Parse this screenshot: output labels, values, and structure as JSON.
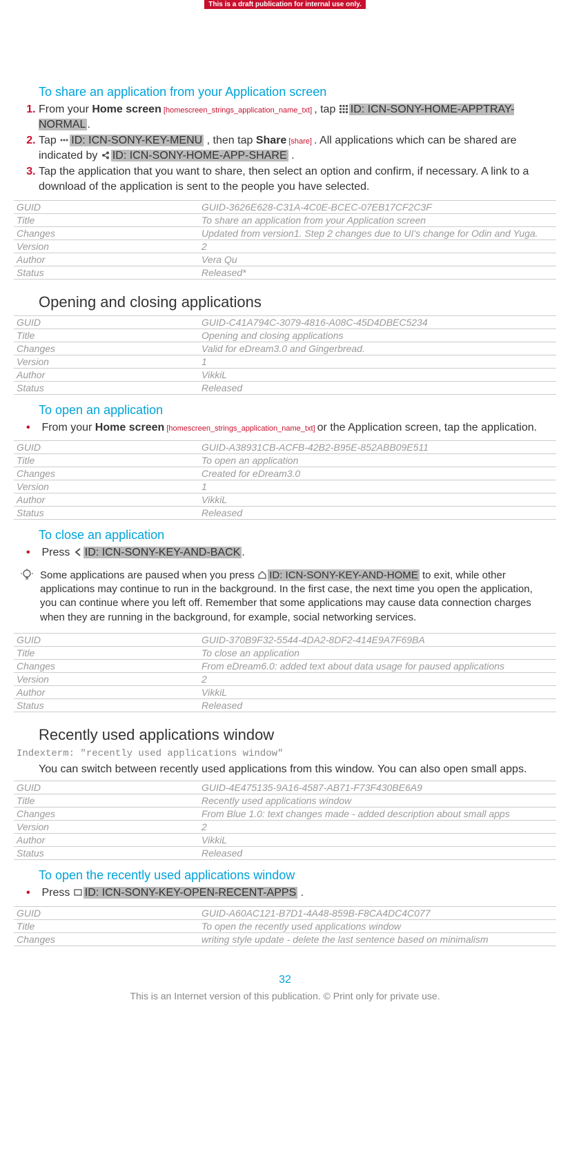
{
  "banner": "This is a draft publication for internal use only.",
  "sec1": {
    "title": "To share an application from your Application screen",
    "step1_a": "From your ",
    "step1_home": "Home screen",
    "step1_ref": " [homescreen_strings_application_name_txt] ",
    "step1_b": ", tap ",
    "step1_icon": "ID: ICN-SONY-HOME-APPTRAY-NORMAL",
    "step1_c": ".",
    "step2_a": "Tap ",
    "step2_icon1": "ID: ICN-SONY-KEY-MENU",
    "step2_b": " , then tap ",
    "step2_share": "Share",
    "step2_ref": " [share] ",
    "step2_c": ". All applications which can be shared are indicated by ",
    "step2_icon2": "ID: ICN-SONY-HOME-APP-SHARE",
    "step2_d": " .",
    "step3": "Tap the application that you want to share, then select an option and confirm, if necessary. A link to a download of the application is sent to the people you have selected."
  },
  "meta1": {
    "GUID": "GUID-3626E628-C31A-4C0E-BCEC-07EB17CF2C3F",
    "Title": "To share an application from your Application screen",
    "Changes": "Updated from version1. Step 2 changes due to UI's change for Odin and Yuga.",
    "Version": "2",
    "Author": "Vera Qu",
    "Status": "Released*"
  },
  "sec2": {
    "title": "Opening and closing applications"
  },
  "meta2": {
    "GUID": "GUID-C41A794C-3079-4816-A08C-45D4DBEC5234",
    "Title": "Opening and closing applications",
    "Changes": "Valid for eDream3.0 and Gingerbread.",
    "Version": "1",
    "Author": "VikkiL",
    "Status": "Released"
  },
  "sec3": {
    "title": "To open an application",
    "bullet_a": "From your ",
    "bullet_home": "Home screen",
    "bullet_ref": " [homescreen_strings_application_name_txt] ",
    "bullet_b": "or the Application screen, tap the application."
  },
  "meta3": {
    "GUID": "GUID-A38931CB-ACFB-42B2-B95E-852ABB09E511",
    "Title": "To open an application",
    "Changes": "Created for eDream3.0",
    "Version": "1",
    "Author": "VikkiL",
    "Status": "Released"
  },
  "sec4": {
    "title": "To close an application",
    "bullet_a": "Press ",
    "bullet_icon": "ID: ICN-SONY-KEY-AND-BACK",
    "bullet_b": ".",
    "tip_a": "Some applications are paused when you press ",
    "tip_icon": "ID: ICN-SONY-KEY-AND-HOME",
    "tip_b": " to exit, while other applications may continue to run in the background. In the first case, the next time you open the application, you can continue where you left off. Remember that some applications may cause data connection charges when they are running in the background, for example, social networking services."
  },
  "meta4": {
    "GUID": "GUID-370B9F32-5544-4DA2-8DF2-414E9A7F69BA",
    "Title": "To close an application",
    "Changes": "From eDream6.0: added text about data usage for paused applications",
    "Version": "2",
    "Author": "VikkiL",
    "Status": "Released"
  },
  "sec5": {
    "title": "Recently used applications window",
    "indexterm": "Indexterm: \"recently used applications window\"",
    "para": "You can switch between recently used applications from this window. You can also open small apps."
  },
  "meta5": {
    "GUID": "GUID-4E475135-9A16-4587-AB71-F73F430BE6A9",
    "Title": "Recently used applications window",
    "Changes": "From Blue 1.0: text changes made - added description about small apps",
    "Version": "2",
    "Author": "VikkiL",
    "Status": "Released"
  },
  "sec6": {
    "title": "To open the recently used applications window",
    "bullet_a": "Press ",
    "bullet_icon": "ID: ICN-SONY-KEY-OPEN-RECENT-APPS",
    "bullet_b": " ."
  },
  "meta6": {
    "GUID": "GUID-A60AC121-B7D1-4A48-859B-F8CA4DC4C077",
    "Title": "To open the recently used applications window",
    "Changes": "writing style update - delete the last sentence based on minimalism"
  },
  "labels": {
    "GUID": "GUID",
    "Title": "Title",
    "Changes": "Changes",
    "Version": "Version",
    "Author": "Author",
    "Status": "Status"
  },
  "pageNumber": "32",
  "footer": "This is an Internet version of this publication. © Print only for private use."
}
